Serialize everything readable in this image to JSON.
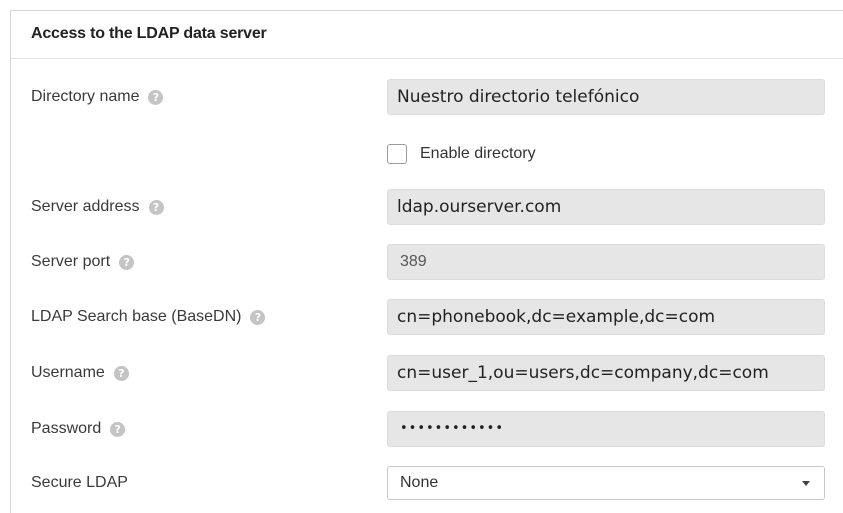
{
  "section": {
    "title": "Access to the LDAP data server"
  },
  "fields": {
    "directory_name": {
      "label": "Directory name",
      "value": "Nuestro directorio telefónico"
    },
    "enable_directory": {
      "label": "Enable directory",
      "checked": false
    },
    "server_address": {
      "label": "Server address",
      "value": "ldap.ourserver.com"
    },
    "server_port": {
      "label": "Server port",
      "value": "389"
    },
    "search_base": {
      "label": "LDAP Search base (BaseDN)",
      "value": "cn=phonebook,dc=example,dc=com"
    },
    "username": {
      "label": "Username",
      "value": "cn=user_1,ou=users,dc=company,dc=com"
    },
    "password": {
      "label": "Password",
      "value": "••••••••••••"
    },
    "secure_ldap": {
      "label": "Secure LDAP",
      "value": "None"
    }
  },
  "icons": {
    "help": "help-icon",
    "help_glyph": "?",
    "dropdown": "chevron-down-icon"
  },
  "colors": {
    "field_background": "#e6e6e6",
    "help_icon": "#c4c4c4",
    "border": "#d6d6d6"
  }
}
